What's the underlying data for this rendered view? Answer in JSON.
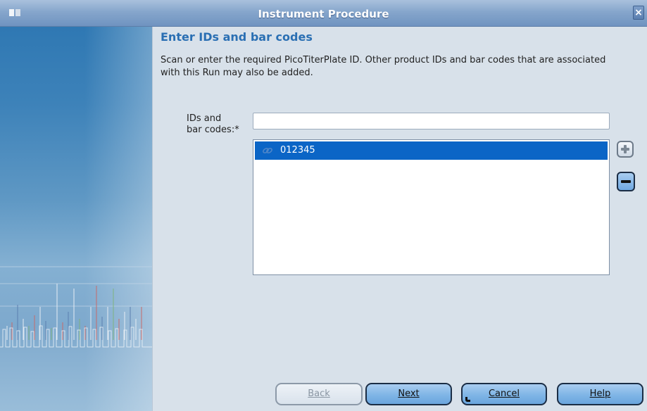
{
  "window": {
    "title": "Instrument Procedure",
    "close_glyph": "×"
  },
  "page": {
    "heading": "Enter IDs and bar codes",
    "description": "Scan or enter the required PicoTiterPlate ID. Other product IDs and bar codes that are associated with this Run may also be added."
  },
  "form": {
    "label_line1": "IDs and",
    "label_line2": "bar codes:*",
    "input_value": "",
    "items": [
      "012345"
    ]
  },
  "buttons": {
    "back": "Back",
    "next": "Next",
    "cancel": "Cancel",
    "help": "Help"
  },
  "colors": {
    "accent": "#2a6fb3",
    "selection": "#0b65c6",
    "button_fill": "#7fb5e6"
  }
}
